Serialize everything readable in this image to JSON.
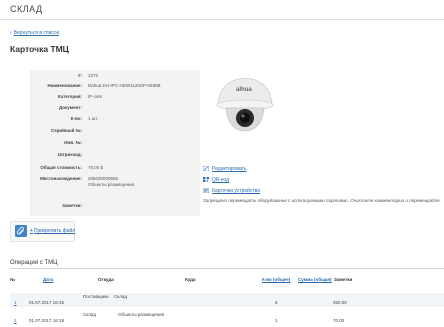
{
  "app": {
    "title": "СКЛАД"
  },
  "nav": {
    "back_label": "Вернуться в список",
    "back_icon": "chevron-left-icon"
  },
  "card": {
    "title": "Карточка ТМЦ",
    "fields": [
      {
        "label": "#:",
        "value": "1272"
      },
      {
        "label": "Наименование:",
        "value": "Dahua DH-IPC-HDW1120SP-0280B"
      },
      {
        "label": "Категория:",
        "value": "IP-cam"
      },
      {
        "label": "Документ:",
        "value": ""
      },
      {
        "label": "К-во:",
        "value": "1 шт."
      },
      {
        "label": "Серийный №:",
        "value": ""
      },
      {
        "label": "Инв. №:",
        "value": ""
      },
      {
        "label": "Штрихкод:",
        "value": ""
      },
      {
        "label": "Общая стоимость:",
        "value": "70.00 $"
      },
      {
        "label": "Местонахождение:",
        "value": "206030000655",
        "value2": "Объекты размещения"
      },
      {
        "label": "Заметки:",
        "value": ""
      }
    ]
  },
  "photo": {
    "brand": "alhua"
  },
  "actions": {
    "edit": "Редактировать",
    "qr": "QR-код",
    "device_card": "Карточка устройства"
  },
  "warning": "Запрещено перемещать оборудование с используемыми партиями. Очистите комментарии и перемещайте.",
  "attach": {
    "label": "Прикрепить файл"
  },
  "operations": {
    "title": "Операции с ТМЦ",
    "columns": {
      "num": "№",
      "date": "Дата",
      "from": "Откуда",
      "to": "Куда",
      "qty": "К-во (общее)",
      "sum": "Сумма (общая)",
      "notes": "Заметки"
    },
    "rows": [
      {
        "num": "1",
        "date": "01.07.2017 16:15",
        "from_a": "Поставщики",
        "from_b": "Склад",
        "to": "",
        "qty": "5",
        "sum": "350.00"
      },
      {
        "num": "2",
        "date": "01.07.2017 16:19",
        "from_a": "Склад",
        "from_b": "",
        "to": "Объекты размещения",
        "qty": "1",
        "sum": "70.00"
      }
    ]
  },
  "colors": {
    "link": "#2a6db0",
    "panel": "#f3f3f3",
    "row_alt": "#f1f5f8"
  }
}
